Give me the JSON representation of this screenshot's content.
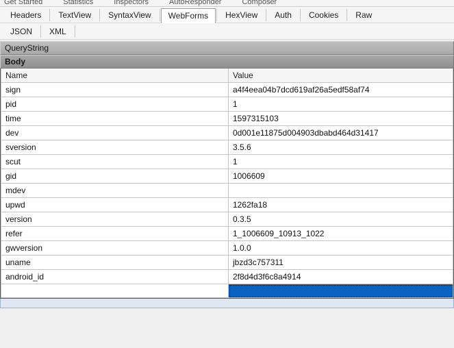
{
  "top_cutoff": {
    "a": "Get Started",
    "b": "Statistics",
    "c": "Inspectors",
    "d": "AutoResponder",
    "e": "Composer"
  },
  "tabs_row1": [
    "Headers",
    "TextView",
    "SyntaxView",
    "WebForms",
    "HexView",
    "Auth",
    "Cookies",
    "Raw"
  ],
  "tabs_row2": [
    "JSON",
    "XML"
  ],
  "active_tab": "WebForms",
  "sections": {
    "querystring": "QueryString",
    "body": "Body"
  },
  "columns": {
    "name": "Name",
    "value": "Value"
  },
  "body_rows": [
    {
      "name": "sign",
      "value": "a4f4eea04b7dcd619af26a5edf58af74"
    },
    {
      "name": "pid",
      "value": "1"
    },
    {
      "name": "time",
      "value": "1597315103"
    },
    {
      "name": "dev",
      "value": "0d001e11875d004903dbabd464d31417"
    },
    {
      "name": "sversion",
      "value": "3.5.6"
    },
    {
      "name": "scut",
      "value": "1"
    },
    {
      "name": "gid",
      "value": "1006609"
    },
    {
      "name": "mdev",
      "value": ""
    },
    {
      "name": "upwd",
      "value": "1262fa18"
    },
    {
      "name": "version",
      "value": "0.3.5"
    },
    {
      "name": "refer",
      "value": "1_1006609_10913_1022"
    },
    {
      "name": "gwversion",
      "value": "1.0.0"
    },
    {
      "name": "uname",
      "value": "jbzd3c757311"
    },
    {
      "name": "android_id",
      "value": "2f8d4d3f6c8a4914"
    }
  ],
  "selected_row_index": 14
}
